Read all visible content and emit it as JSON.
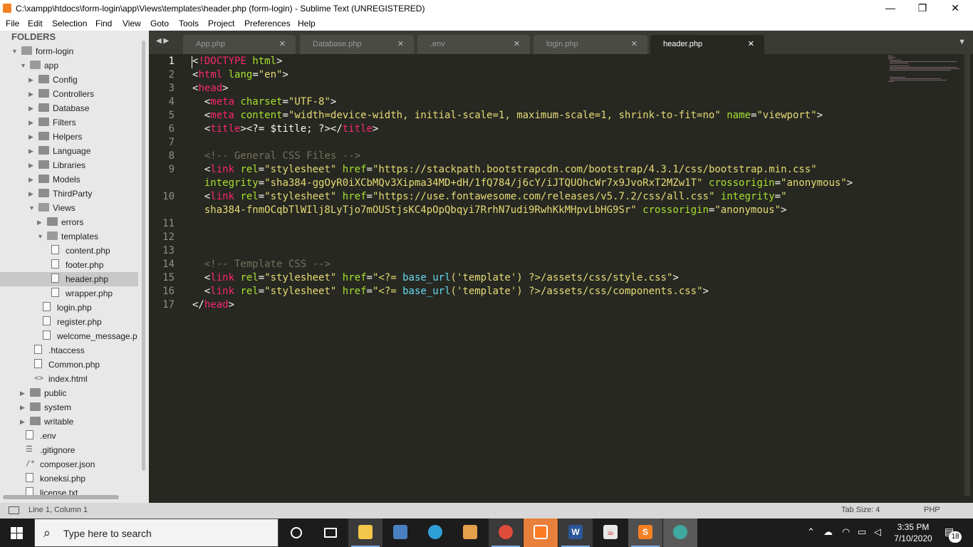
{
  "window": {
    "title": "C:\\xampp\\htdocs\\form-login\\app\\Views\\templates\\header.php (form-login) - Sublime Text (UNREGISTERED)",
    "minimize": "—",
    "maximize": "❐",
    "close": "✕"
  },
  "menu": [
    "File",
    "Edit",
    "Selection",
    "Find",
    "View",
    "Goto",
    "Tools",
    "Project",
    "Preferences",
    "Help"
  ],
  "sidebar": {
    "header": "FOLDERS",
    "items": [
      {
        "label": "form-login",
        "type": "folder-open",
        "depth": 0
      },
      {
        "label": "app",
        "type": "folder-open",
        "depth": 1
      },
      {
        "label": "Config",
        "type": "folder",
        "depth": 2
      },
      {
        "label": "Controllers",
        "type": "folder",
        "depth": 2
      },
      {
        "label": "Database",
        "type": "folder",
        "depth": 2
      },
      {
        "label": "Filters",
        "type": "folder",
        "depth": 2
      },
      {
        "label": "Helpers",
        "type": "folder",
        "depth": 2
      },
      {
        "label": "Language",
        "type": "folder",
        "depth": 2
      },
      {
        "label": "Libraries",
        "type": "folder",
        "depth": 2
      },
      {
        "label": "Models",
        "type": "folder",
        "depth": 2
      },
      {
        "label": "ThirdParty",
        "type": "folder",
        "depth": 2
      },
      {
        "label": "Views",
        "type": "folder-open",
        "depth": 2
      },
      {
        "label": "errors",
        "type": "folder",
        "depth": 3
      },
      {
        "label": "templates",
        "type": "folder-open",
        "depth": 3
      },
      {
        "label": "content.php",
        "type": "file",
        "depth": 4
      },
      {
        "label": "footer.php",
        "type": "file",
        "depth": 4
      },
      {
        "label": "header.php",
        "type": "file",
        "depth": 4,
        "selected": true
      },
      {
        "label": "wrapper.php",
        "type": "file",
        "depth": 4
      },
      {
        "label": "login.php",
        "type": "file",
        "depth": 3
      },
      {
        "label": "register.php",
        "type": "file",
        "depth": 3
      },
      {
        "label": "welcome_message.p",
        "type": "file",
        "depth": 3
      },
      {
        "label": ".htaccess",
        "type": "file",
        "depth": 2
      },
      {
        "label": "Common.php",
        "type": "file",
        "depth": 2
      },
      {
        "label": "index.html",
        "type": "code",
        "depth": 2
      },
      {
        "label": "public",
        "type": "folder",
        "depth": 1
      },
      {
        "label": "system",
        "type": "folder",
        "depth": 1
      },
      {
        "label": "writable",
        "type": "folder",
        "depth": 1
      },
      {
        "label": ".env",
        "type": "file",
        "depth": 1
      },
      {
        "label": ".gitignore",
        "type": "list",
        "depth": 1
      },
      {
        "label": "composer.json",
        "type": "comment",
        "depth": 1
      },
      {
        "label": "koneksi.php",
        "type": "file",
        "depth": 1
      },
      {
        "label": "license.txt",
        "type": "file",
        "depth": 1
      }
    ]
  },
  "tabs": [
    {
      "label": "App.php",
      "active": false
    },
    {
      "label": "Database.php",
      "active": false
    },
    {
      "label": ".env",
      "active": false
    },
    {
      "label": "login.php",
      "active": false
    },
    {
      "label": "header.php",
      "active": true
    }
  ],
  "tab_close": "✕",
  "tab_nav": "◀ ▶",
  "tab_dropdown": "▼",
  "code": {
    "line_numbers": [
      "1",
      "2",
      "3",
      "4",
      "5",
      "6",
      "7",
      "8",
      "9",
      "",
      "10",
      "",
      "11",
      "12",
      "13",
      "14",
      "15",
      "16",
      "17"
    ],
    "lines": [
      [
        [
          "t",
          "<"
        ],
        [
          "tag",
          "!DOCTYPE"
        ],
        [
          "t",
          " "
        ],
        [
          "attr",
          "html"
        ],
        [
          "t",
          ">"
        ]
      ],
      [
        [
          "t",
          "<"
        ],
        [
          "tag",
          "html"
        ],
        [
          "t",
          " "
        ],
        [
          "attr",
          "lang"
        ],
        [
          "t",
          "="
        ],
        [
          "str",
          "\"en\""
        ],
        [
          "t",
          ">"
        ]
      ],
      [
        [
          "t",
          "<"
        ],
        [
          "tag",
          "head"
        ],
        [
          "t",
          ">"
        ]
      ],
      [
        [
          "t",
          "  <"
        ],
        [
          "tag",
          "meta"
        ],
        [
          "t",
          " "
        ],
        [
          "attr",
          "charset"
        ],
        [
          "t",
          "="
        ],
        [
          "str",
          "\"UTF-8\""
        ],
        [
          "t",
          ">"
        ]
      ],
      [
        [
          "t",
          "  <"
        ],
        [
          "tag",
          "meta"
        ],
        [
          "t",
          " "
        ],
        [
          "attr",
          "content"
        ],
        [
          "t",
          "="
        ],
        [
          "str",
          "\"width=device-width, initial-scale=1, maximum-scale=1, shrink-to-fit=no\""
        ],
        [
          "t",
          " "
        ],
        [
          "attr",
          "name"
        ],
        [
          "t",
          "="
        ],
        [
          "str",
          "\"viewport\""
        ],
        [
          "t",
          ">"
        ]
      ],
      [
        [
          "t",
          "  <"
        ],
        [
          "tag",
          "title"
        ],
        [
          "t",
          "><?= $title; ?></"
        ],
        [
          "tag",
          "title"
        ],
        [
          "t",
          ">"
        ]
      ],
      [
        [
          "t",
          ""
        ]
      ],
      [
        [
          "cmt",
          "  <!-- General CSS Files -->"
        ]
      ],
      [
        [
          "t",
          "  <"
        ],
        [
          "tag",
          "link"
        ],
        [
          "t",
          " "
        ],
        [
          "attr",
          "rel"
        ],
        [
          "t",
          "="
        ],
        [
          "str",
          "\"stylesheet\""
        ],
        [
          "t",
          " "
        ],
        [
          "attr",
          "href"
        ],
        [
          "t",
          "="
        ],
        [
          "str",
          "\"https://stackpath.bootstrapcdn.com/bootstrap/4.3.1/css/bootstrap.min.css\""
        ]
      ],
      [
        [
          "t",
          "  "
        ],
        [
          "attr",
          "integrity"
        ],
        [
          "t",
          "="
        ],
        [
          "str",
          "\"sha384-ggOyR0iXCbMQv3Xipma34MD+dH/1fQ784/j6cY/iJTQUOhcWr7x9JvoRxT2MZw1T\""
        ],
        [
          "t",
          " "
        ],
        [
          "attr",
          "crossorigin"
        ],
        [
          "t",
          "="
        ],
        [
          "str",
          "\"anonymous\""
        ],
        [
          "t",
          ">"
        ]
      ],
      [
        [
          "t",
          "  <"
        ],
        [
          "tag",
          "link"
        ],
        [
          "t",
          " "
        ],
        [
          "attr",
          "rel"
        ],
        [
          "t",
          "="
        ],
        [
          "str",
          "\"stylesheet\""
        ],
        [
          "t",
          " "
        ],
        [
          "attr",
          "href"
        ],
        [
          "t",
          "="
        ],
        [
          "str",
          "\"https://use.fontawesome.com/releases/v5.7.2/css/all.css\""
        ],
        [
          "t",
          " "
        ],
        [
          "attr",
          "integrity"
        ],
        [
          "t",
          "="
        ],
        [
          "str",
          "\""
        ]
      ],
      [
        [
          "str",
          "  sha384-fnmOCqbTlWIlj8LyTjo7mOUStjsKC4pOpQbqyi7RrhN7udi9RwhKkMHpvLbHG9Sr\""
        ],
        [
          "t",
          " "
        ],
        [
          "attr",
          "crossorigin"
        ],
        [
          "t",
          "="
        ],
        [
          "str",
          "\"anonymous\""
        ],
        [
          "t",
          ">"
        ]
      ],
      [
        [
          "t",
          ""
        ]
      ],
      [
        [
          "t",
          ""
        ]
      ],
      [
        [
          "t",
          ""
        ]
      ],
      [
        [
          "cmt",
          "  <!-- Template CSS -->"
        ]
      ],
      [
        [
          "t",
          "  <"
        ],
        [
          "tag",
          "link"
        ],
        [
          "t",
          " "
        ],
        [
          "attr",
          "rel"
        ],
        [
          "t",
          "="
        ],
        [
          "str",
          "\"stylesheet\""
        ],
        [
          "t",
          " "
        ],
        [
          "attr",
          "href"
        ],
        [
          "t",
          "="
        ],
        [
          "str",
          "\"<?= "
        ],
        [
          "fn",
          "base_url"
        ],
        [
          "str",
          "('template') ?>/assets/css/style.css\""
        ],
        [
          "t",
          ">"
        ]
      ],
      [
        [
          "t",
          "  <"
        ],
        [
          "tag",
          "link"
        ],
        [
          "t",
          " "
        ],
        [
          "attr",
          "rel"
        ],
        [
          "t",
          "="
        ],
        [
          "str",
          "\"stylesheet\""
        ],
        [
          "t",
          " "
        ],
        [
          "attr",
          "href"
        ],
        [
          "t",
          "="
        ],
        [
          "str",
          "\"<?= "
        ],
        [
          "fn",
          "base_url"
        ],
        [
          "str",
          "('template') ?>/assets/css/components.css\""
        ],
        [
          "t",
          ">"
        ]
      ],
      [
        [
          "t",
          "</"
        ],
        [
          "tag",
          "head"
        ],
        [
          "t",
          ">"
        ]
      ]
    ]
  },
  "status": {
    "position": "Line 1, Column 1",
    "tab_size": "Tab Size: 4",
    "syntax": "PHP"
  },
  "taskbar": {
    "search_placeholder": "Type here to search",
    "apps": [
      "cortana",
      "task-view",
      "file-explorer",
      "virtualbox",
      "edge",
      "store",
      "chrome",
      "xampp",
      "word",
      "java",
      "sublime-text",
      "edge-dev"
    ],
    "time": "3:35 PM",
    "date": "7/10/2020",
    "notifications": "18"
  },
  "colors": {
    "editor_bg": "#272822",
    "tag": "#f92672",
    "attr": "#a6e22e",
    "string": "#e6db74",
    "comment": "#75715e",
    "function": "#66d9ef"
  }
}
